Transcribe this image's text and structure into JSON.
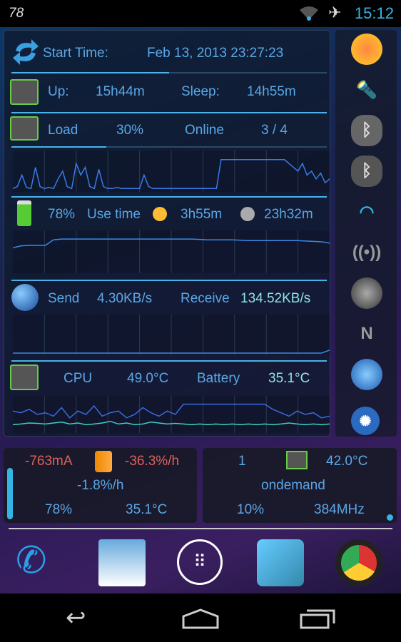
{
  "status_bar": {
    "battery_level": "78",
    "time": "15:12",
    "icons": [
      "wifi-icon",
      "airplane-icon"
    ]
  },
  "panel": {
    "start": {
      "label": "Start Time:",
      "value": "Feb 13, 2013 23:27:23",
      "progress": 0.5
    },
    "uptime": {
      "up_label": "Up:",
      "up_value": "15h44m",
      "sleep_label": "Sleep:",
      "sleep_value": "14h55m"
    },
    "load": {
      "label": "Load",
      "value": "30%",
      "online_label": "Online",
      "online_value": "3 / 4",
      "progress": 0.3,
      "graph": [
        5,
        10,
        40,
        8,
        5,
        60,
        10,
        5,
        8,
        5,
        30,
        50,
        10,
        5,
        70,
        40,
        60,
        10,
        5,
        55,
        10,
        5,
        5,
        8,
        5,
        5,
        5,
        5,
        5,
        40,
        10,
        5,
        5,
        5,
        5,
        5,
        5,
        5,
        5,
        5,
        5,
        5,
        5,
        5,
        5,
        5,
        80,
        80,
        80,
        80,
        80,
        80,
        80,
        80,
        80,
        80,
        80,
        80,
        80,
        80,
        80,
        70,
        60,
        50,
        70,
        40,
        50,
        30,
        45,
        20,
        30
      ]
    },
    "battery": {
      "level": "78%",
      "use_label": "Use time",
      "screen_on": "3h55m",
      "screen_off": "23h32m",
      "graph": [
        60,
        65,
        66,
        66,
        66,
        80,
        82,
        82,
        82,
        82,
        82,
        82,
        82,
        82,
        82,
        82,
        82,
        82,
        82,
        82,
        82,
        82,
        82,
        81,
        80,
        80,
        80,
        80,
        79,
        78,
        78,
        78,
        78,
        78,
        78,
        78,
        77,
        76,
        75,
        72
      ]
    },
    "network": {
      "send_label": "Send",
      "send_value": "4.30KB/s",
      "receive_label": "Receive",
      "receive_value": "134.52KB/s",
      "graph": [
        0,
        0,
        0,
        0,
        0,
        0,
        0,
        0,
        0,
        0,
        0,
        0,
        0,
        0,
        0,
        0,
        0,
        0,
        0,
        0,
        0,
        0,
        0,
        0,
        0,
        0,
        0,
        0,
        0,
        0,
        0,
        0,
        0,
        0,
        0,
        0,
        0,
        0,
        0,
        8
      ]
    },
    "temperature": {
      "cpu_label": "CPU",
      "cpu_value": "49.0°C",
      "battery_label": "Battery",
      "battery_value": "35.1°C",
      "cpu_graph": [
        60,
        55,
        65,
        50,
        55,
        45,
        70,
        40,
        60,
        50,
        75,
        45,
        55,
        60,
        40,
        50,
        70,
        55,
        45,
        60,
        50,
        80,
        80,
        80,
        80,
        80,
        80,
        80,
        80,
        80,
        80,
        80,
        65,
        55,
        45,
        60,
        50,
        55,
        40,
        45
      ],
      "battery_graph": [
        20,
        22,
        25,
        24,
        22,
        25,
        28,
        22,
        25,
        20,
        22,
        25,
        30,
        22,
        25,
        20,
        22,
        28,
        25,
        22,
        24,
        22,
        20,
        22,
        20,
        22,
        20,
        22,
        20,
        22,
        20,
        22,
        20,
        22,
        25,
        22,
        20,
        22,
        20,
        22
      ]
    }
  },
  "toggles": [
    "brightness-sun-icon",
    "flashlight-icon",
    "bluetooth-icon",
    "bluetooth-discoverable-icon",
    "wifi-icon",
    "wifi-hotspot-icon",
    "gps-globe-icon",
    "nfc-icon",
    "mobile-data-globe-icon",
    "sync-icon"
  ],
  "toggle_labels": {
    "nfc": "N"
  },
  "battery_widget": {
    "current": "-763mA",
    "rate": "-36.3%/h",
    "average": "-1.8%/h",
    "level": "78%",
    "temp": "35.1°C",
    "level_fraction": 0.78
  },
  "cpu_widget": {
    "cores": "1",
    "temp": "42.0°C",
    "governor": "ondemand",
    "load": "10%",
    "freq": "384MHz",
    "load_fraction": 0.1
  },
  "dock": [
    "phone-icon",
    "contacts-icon",
    "app-drawer-icon",
    "system-tuner-icon",
    "chrome-icon"
  ],
  "nav": [
    "back-icon",
    "home-icon",
    "recents-icon"
  ]
}
